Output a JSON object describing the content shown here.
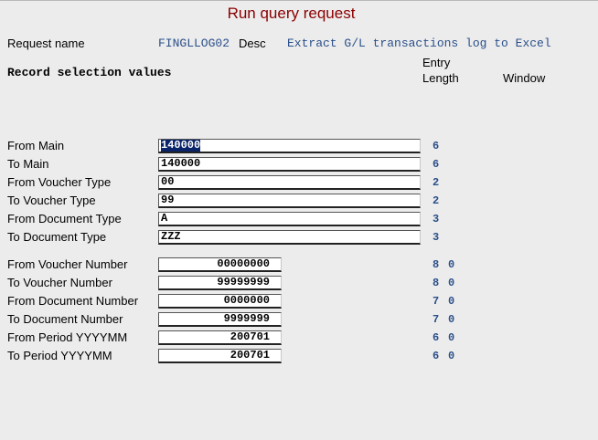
{
  "title": "Run query request",
  "header": {
    "request_name_label": "Request name",
    "request_name_value": "FINGLLOG02",
    "desc_label": "Desc",
    "desc_value": "Extract G/L transactions log to Excel",
    "record_selection_label": "Record selection values",
    "entry_label": "Entry",
    "length_label": "Length",
    "window_label": "Window"
  },
  "fields": [
    {
      "label": "From Main",
      "value": "140000",
      "length": "6",
      "window": ""
    },
    {
      "label": "To Main",
      "value": "140000",
      "length": "6",
      "window": ""
    },
    {
      "label": "From Voucher Type",
      "value": "00",
      "length": "2",
      "window": ""
    },
    {
      "label": "To Voucher Type",
      "value": "99",
      "length": "2",
      "window": ""
    },
    {
      "label": "From Document Type",
      "value": "A",
      "length": "3",
      "window": ""
    },
    {
      "label": "To Document Type",
      "value": "ZZZ",
      "length": "3",
      "window": ""
    },
    {
      "label": "From Voucher Number",
      "value": "00000000",
      "length": "8",
      "window": "0"
    },
    {
      "label": "To Voucher Number",
      "value": "99999999",
      "length": "8",
      "window": "0"
    },
    {
      "label": "From Document Number",
      "value": "0000000",
      "length": "7",
      "window": "0"
    },
    {
      "label": "To Document Number",
      "value": "9999999",
      "length": "7",
      "window": "0"
    },
    {
      "label": "From Period YYYYMM",
      "value": "200701",
      "length": "6",
      "window": "0"
    },
    {
      "label": "To Period YYYYMM",
      "value": "200701",
      "length": "6",
      "window": "0"
    }
  ],
  "colors": {
    "title": "#8b0000",
    "code_text": "#2a4f8a",
    "background": "#ececec",
    "selection": "#0a246a"
  }
}
